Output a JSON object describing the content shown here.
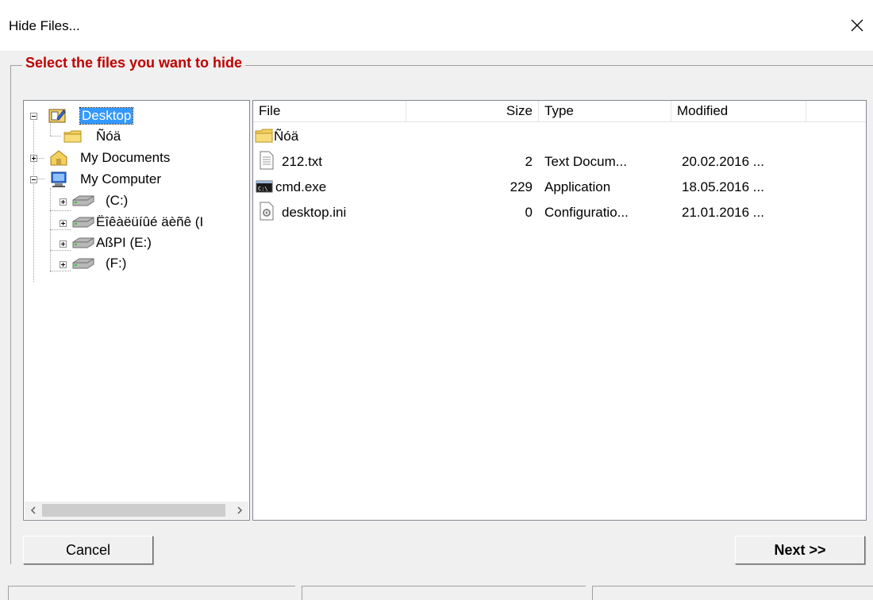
{
  "window": {
    "title": "Hide Files..."
  },
  "group": {
    "legend": "Select the files you want to hide"
  },
  "tree": {
    "items": [
      {
        "label": "Desktop",
        "icon": "desktop-icon",
        "selected": true
      },
      {
        "label": "Ñóä",
        "icon": "folder-icon"
      },
      {
        "label": "My Documents",
        "icon": "my-documents-icon"
      },
      {
        "label": "My Computer",
        "icon": "computer-icon"
      },
      {
        "label": " (C:)",
        "icon": "drive-icon"
      },
      {
        "label": "Ëîêàëüíûé äèñê (I",
        "icon": "drive-icon"
      },
      {
        "label": "AßPI (E:)",
        "icon": "drive-icon"
      },
      {
        "label": " (F:)",
        "icon": "drive-icon"
      }
    ]
  },
  "list": {
    "columns": [
      "File",
      "Size",
      "Type",
      "Modified"
    ],
    "rows": [
      {
        "name": "Ñóä",
        "size": "",
        "type": "",
        "modified": "",
        "icon": "folder-icon"
      },
      {
        "name": "212.txt",
        "size": "2",
        "type": "Text Docum...",
        "modified": "20.02.2016 ...",
        "icon": "text-file-icon"
      },
      {
        "name": "cmd.exe",
        "size": "229",
        "type": "Application",
        "modified": "18.05.2016 ...",
        "icon": "console-app-icon"
      },
      {
        "name": "desktop.ini",
        "size": "0",
        "type": "Configuratio...",
        "modified": "21.01.2016 ...",
        "icon": "settings-file-icon"
      }
    ]
  },
  "buttons": {
    "cancel": "Cancel",
    "next": "Next >>"
  },
  "colors": {
    "legend": "#c00000",
    "selection": "#3399ff"
  }
}
